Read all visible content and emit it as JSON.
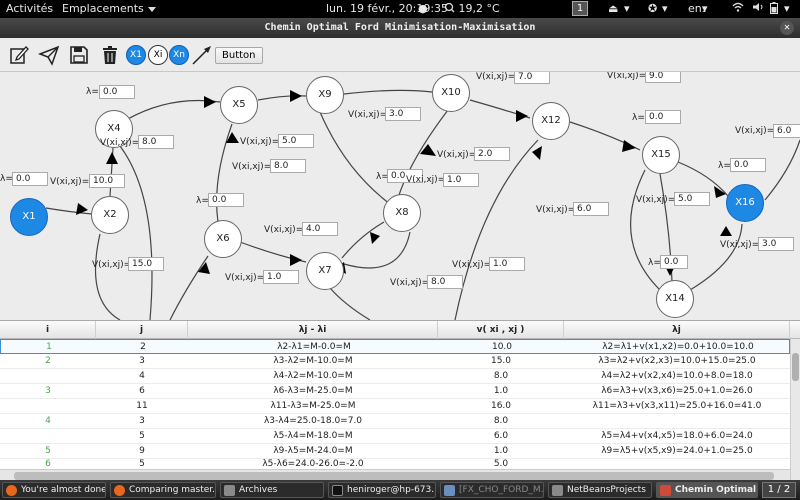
{
  "topbar": {
    "activities": "Activités",
    "places": "Emplacements",
    "clock": "lun. 19 févr., 20:19:35",
    "weather": "19,2 °C",
    "workspace": "1",
    "language": "en₁"
  },
  "window": {
    "title": "Chemin Optimal Ford Minimisation-Maximisation"
  },
  "toolbar": {
    "node_x1": "X1",
    "node_xi": "Xi",
    "node_xn": "Xn",
    "button_label": "Button"
  },
  "graph": {
    "nodes": {
      "x1": "X1",
      "x2": "X2",
      "x4": "X4",
      "x5": "X5",
      "x6": "X6",
      "x7": "X7",
      "x8": "X8",
      "x9": "X9",
      "x10": "X10",
      "x12": "X12",
      "x14": "X14",
      "x15": "X15",
      "x16": "X16"
    },
    "lambda_label": "λ=",
    "lambda_label_j": "λ=",
    "v_label": "V(xi,xj)=",
    "values": {
      "l_x4": "0.0",
      "l_x1": "0.0",
      "v_12": "10.0",
      "v_24": "8.0",
      "v_23": "15.0",
      "l_x6": "0.0",
      "v_56": "5.0",
      "v_47": "8.0",
      "v_67": "1.0",
      "v_7j": "4.0",
      "v_59": "3.0",
      "l_x8": "0.0",
      "v_810": "2.0",
      "v_89": "1.0",
      "v_7x": "8.0",
      "v_x": "1.0",
      "v_912": "7.0",
      "v_1213": "6.0",
      "v_top": "9.0",
      "l_x15": "0.0",
      "v_1516": "6.0",
      "l_x16": "0.0",
      "v_1514": "5.0",
      "v_1416": "3.0",
      "l_x14": "0.0"
    }
  },
  "table": {
    "headers": [
      "i",
      "j",
      "λj - λi",
      "v( xi , xj )",
      "λj"
    ],
    "rows": [
      [
        "1",
        "2",
        "λ2-λ1=M-0.0=M",
        "10.0",
        "λ2=λ1+v(x1,x2)=0.0+10.0=10.0"
      ],
      [
        "2",
        "3",
        "λ3-λ2=M-10.0=M",
        "15.0",
        "λ3=λ2+v(x2,x3)=10.0+15.0=25.0"
      ],
      [
        "",
        "4",
        "λ4-λ2=M-10.0=M",
        "8.0",
        "λ4=λ2+v(x2,x4)=10.0+8.0=18.0"
      ],
      [
        "3",
        "6",
        "λ6-λ3=M-25.0=M",
        "1.0",
        "λ6=λ3+v(x3,x6)=25.0+1.0=26.0"
      ],
      [
        "",
        "11",
        "λ11-λ3=M-25.0=M",
        "16.0",
        "λ11=λ3+v(x3,x11)=25.0+16.0=41.0"
      ],
      [
        "4",
        "3",
        "λ3-λ4=25.0-18.0=7.0",
        "8.0",
        ""
      ],
      [
        "",
        "5",
        "λ5-λ4=M-18.0=M",
        "6.0",
        "λ5=λ4+v(x4,x5)=18.0+6.0=24.0"
      ],
      [
        "5",
        "9",
        "λ9-λ5=M-24.0=M",
        "1.0",
        "λ9=λ5+v(x5,x9)=24.0+1.0=25.0"
      ],
      [
        "6",
        "5",
        "λ5-λ6=24.0-26.0=-2.0",
        "5.0",
        ""
      ]
    ]
  },
  "taskbar": {
    "items": [
      "You're almost done...",
      "Comparing master....",
      "Archives",
      "heniroger@hp-673...",
      "[FX_CHO_FORD_M...",
      "NetBeansProjects",
      "Chemin Optimal Fo..."
    ],
    "pager": "1 / 2"
  }
}
